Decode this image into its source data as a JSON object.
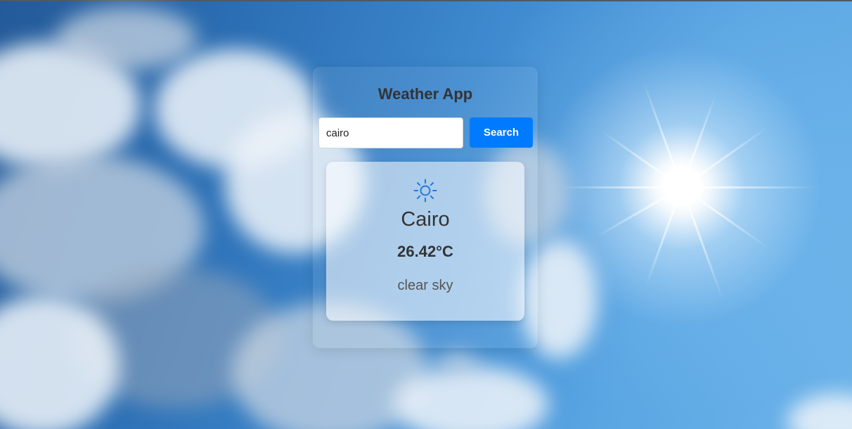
{
  "app": {
    "title": "Weather App"
  },
  "search": {
    "value": "cairo",
    "button_label": "Search"
  },
  "weather": {
    "icon": "sun-icon",
    "city": "Cairo",
    "temperature": "26.42°C",
    "description": "clear sky"
  },
  "colors": {
    "accent": "#007bff",
    "text": "#333333",
    "icon": "#1f7ae0"
  }
}
